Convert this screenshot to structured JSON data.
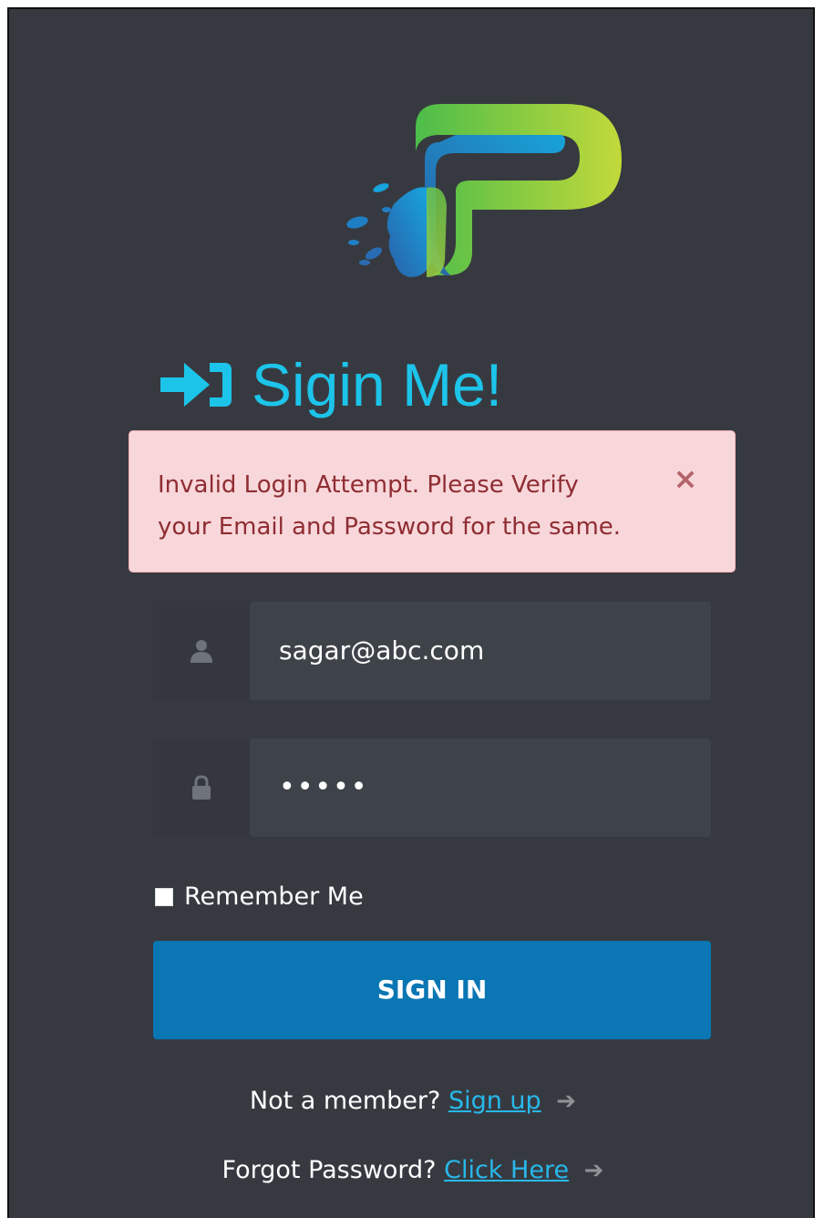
{
  "logo": {
    "name": "app-logo",
    "colors": {
      "green": "#5cc44f",
      "blue": "#0f9fd8",
      "lime": "#b9d73b"
    }
  },
  "heading": {
    "icon": "sign-in-icon",
    "title": "Sigin Me!"
  },
  "alert": {
    "line1": "Invalid Login Attempt. Please Verify",
    "line2": "your Email and Password for the same.",
    "close_label": "×"
  },
  "form": {
    "email": {
      "icon": "user-icon",
      "value": "sagar@abc.com"
    },
    "password": {
      "icon": "lock-icon",
      "value": "•••••"
    },
    "remember_label": "Remember Me",
    "remember_checked": false,
    "submit_label": "SIGN IN"
  },
  "links": {
    "signup_prefix": "Not a member?",
    "signup_link": "Sign up",
    "forgot_prefix": "Forgot Password?",
    "forgot_link": "Click Here",
    "arrow": "➔"
  },
  "colors": {
    "background": "#363a40",
    "accent": "#1dc4ea",
    "button": "#0a76b3",
    "alert_bg": "#f8d7da",
    "alert_text": "#8f2d33"
  }
}
